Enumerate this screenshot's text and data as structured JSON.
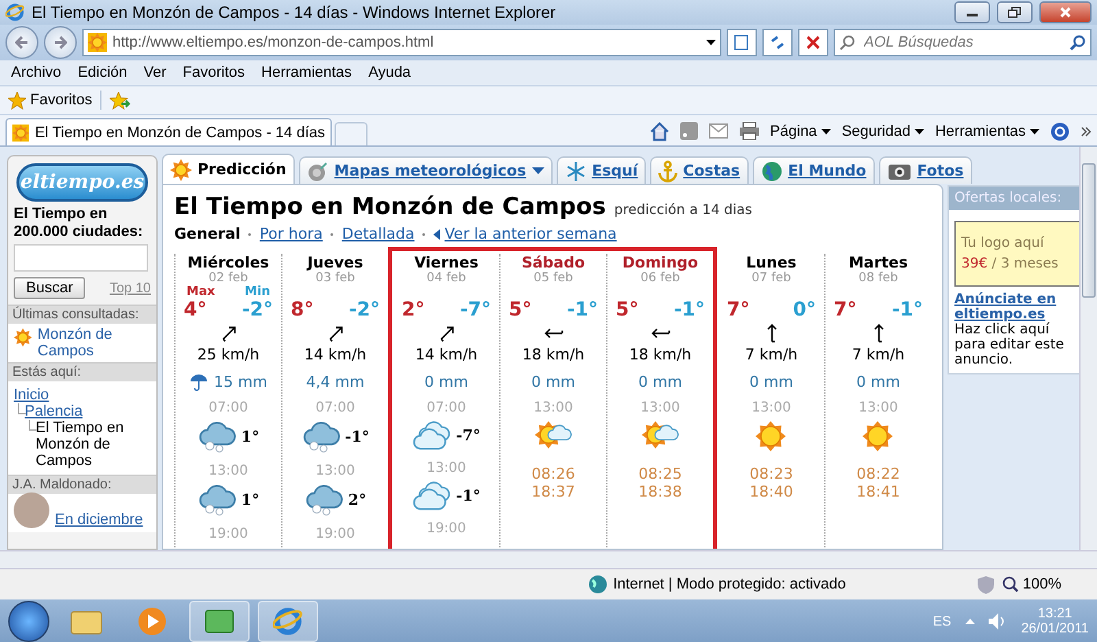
{
  "window": {
    "title": "El Tiempo en Monzón de Campos - 14 días - Windows Internet Explorer"
  },
  "address_bar": {
    "url": "http://www.eltiempo.es/monzon-de-campos.html"
  },
  "search": {
    "placeholder": "AOL Búsquedas"
  },
  "menu": [
    "Archivo",
    "Edición",
    "Ver",
    "Favoritos",
    "Herramientas",
    "Ayuda"
  ],
  "favorites_bar": {
    "label": "Favoritos"
  },
  "browser_tabs": [
    {
      "label": "El Tiempo en Monzón de Campos - 14 días"
    }
  ],
  "command_bar": [
    "Página",
    "Seguridad",
    "Herramientas"
  ],
  "sidebar": {
    "logo": "eltiempo.es",
    "search_label": "El Tiempo en 200.000 ciudades:",
    "search_button": "Buscar",
    "top_link": "Top 10",
    "recent_heading": "Últimas consultadas:",
    "recent": [
      "Monzón de Campos"
    ],
    "breadcrumb_heading": "Estás aquí:",
    "breadcrumb": [
      {
        "label": "Inicio",
        "kind": "link",
        "children": [
          {
            "label": "Palencia",
            "kind": "link",
            "children": [
              {
                "label": "El Tiempo en Monzón de Campos",
                "kind": "current"
              }
            ]
          }
        ]
      }
    ],
    "author_heading": "J.A. Maldonado:",
    "author_link": "En diciembre"
  },
  "page_tabs": [
    {
      "label": "Predicción",
      "selected": true,
      "dropdown": false
    },
    {
      "label": "Mapas meteorológicos",
      "selected": false,
      "dropdown": true
    },
    {
      "label": "Esquí",
      "selected": false,
      "dropdown": false
    },
    {
      "label": "Costas",
      "selected": false,
      "dropdown": false
    },
    {
      "label": "El Mundo",
      "selected": false,
      "dropdown": false
    },
    {
      "label": "Fotos",
      "selected": false,
      "dropdown": false
    }
  ],
  "forecast": {
    "title": "El Tiempo en Monzón de Campos",
    "subtitle": "predicción a 14 dias",
    "views": [
      {
        "label": "General",
        "selected": true
      },
      {
        "label": "Por hora",
        "selected": false
      },
      {
        "label": "Detallada",
        "selected": false
      }
    ],
    "previous_week": "Ver la anterior semana",
    "days": [
      {
        "name": "Miércoles",
        "date": "02 feb",
        "weekend": false,
        "highlighted": false,
        "max_label": "Max",
        "min_label": "Min",
        "max": "4°",
        "min": "-2°",
        "wind": {
          "kind": "ne",
          "speed": "25 km/h"
        },
        "rain_icon": true,
        "rain": "15 mm",
        "slots": [
          {
            "time": "07:00",
            "kind": "snow",
            "temp": "1°"
          },
          {
            "time": "13:00",
            "kind": "snow",
            "temp": "1°"
          },
          {
            "time": "19:00",
            "kind": "none"
          }
        ]
      },
      {
        "name": "Jueves",
        "date": "03 feb",
        "weekend": false,
        "highlighted": false,
        "max": "8°",
        "min": "-2°",
        "wind": {
          "kind": "ne",
          "speed": "14 km/h"
        },
        "rain_icon": false,
        "rain": "4,4 mm",
        "slots": [
          {
            "time": "07:00",
            "kind": "snow",
            "temp": "-1°"
          },
          {
            "time": "13:00",
            "kind": "snow",
            "temp": "2°"
          },
          {
            "time": "19:00",
            "kind": "none"
          }
        ]
      },
      {
        "name": "Viernes",
        "date": "04 feb",
        "weekend": false,
        "highlighted": true,
        "max": "2°",
        "min": "-7°",
        "wind": {
          "kind": "ne",
          "speed": "14 km/h"
        },
        "rain_icon": false,
        "rain": "0 mm",
        "slots": [
          {
            "time": "07:00",
            "kind": "cloud",
            "temp": "-7°"
          },
          {
            "time": "13:00",
            "kind": "cloud",
            "temp": "-1°"
          },
          {
            "time": "19:00",
            "kind": "none"
          }
        ]
      },
      {
        "name": "Sábado",
        "date": "05 feb",
        "weekend": true,
        "highlighted": true,
        "max": "5°",
        "min": "-1°",
        "wind": {
          "kind": "w",
          "speed": "18 km/h"
        },
        "rain_icon": false,
        "rain": "0 mm",
        "slots": [
          {
            "time": "13:00",
            "kind": "sun-cloud"
          }
        ],
        "sunrise": "08:26",
        "sunset": "18:37"
      },
      {
        "name": "Domingo",
        "date": "06 feb",
        "weekend": true,
        "highlighted": true,
        "max": "5°",
        "min": "-1°",
        "wind": {
          "kind": "w",
          "speed": "18 km/h"
        },
        "rain_icon": false,
        "rain": "0 mm",
        "slots": [
          {
            "time": "13:00",
            "kind": "sun-cloud"
          }
        ],
        "sunrise": "08:25",
        "sunset": "18:38"
      },
      {
        "name": "Lunes",
        "date": "07 feb",
        "weekend": false,
        "highlighted": false,
        "max": "7°",
        "min": "0°",
        "wind": {
          "kind": "n",
          "speed": "7 km/h"
        },
        "rain_icon": false,
        "rain": "0 mm",
        "slots": [
          {
            "time": "13:00",
            "kind": "sun"
          }
        ],
        "sunrise": "08:23",
        "sunset": "18:40"
      },
      {
        "name": "Martes",
        "date": "08 feb",
        "weekend": false,
        "highlighted": false,
        "max": "7°",
        "min": "-1°",
        "wind": {
          "kind": "n",
          "speed": "7 km/h"
        },
        "rain_icon": false,
        "rain": "0 mm",
        "slots": [
          {
            "time": "13:00",
            "kind": "sun"
          }
        ],
        "sunrise": "08:22",
        "sunset": "18:41"
      }
    ]
  },
  "ads": {
    "heading": "Ofertas locales:",
    "box_text": "Tu logo aquí",
    "price": "39€",
    "period": "/ 3 meses",
    "link": "Anúnciate en eltiempo.es",
    "text": "Haz click aquí para editar este anuncio."
  },
  "status_bar": {
    "zone": "Internet | Modo protegido: activado",
    "zoom": "100%"
  },
  "taskbar": {
    "language": "ES",
    "time": "13:21",
    "date": "26/01/2011"
  }
}
